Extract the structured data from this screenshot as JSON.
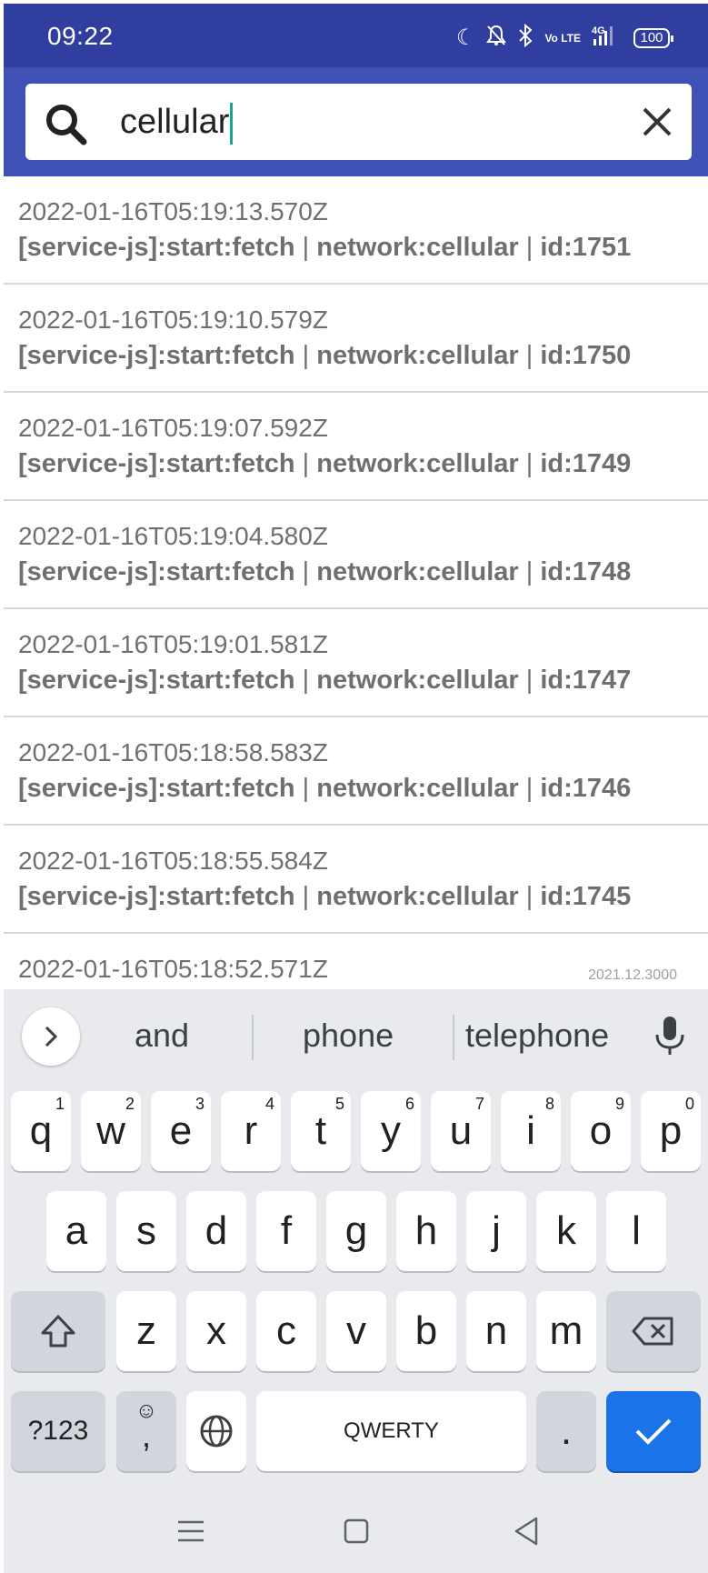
{
  "status_bar": {
    "time": "09:22",
    "battery": "100",
    "network": "4G",
    "volte": "Vo LTE"
  },
  "search": {
    "value": "cellular"
  },
  "logs": [
    {
      "timestamp": "2022-01-16T05:19:13.570Z",
      "source": "[service-js]:start:fetch",
      "network": "network:cellular",
      "id": "id:1751"
    },
    {
      "timestamp": "2022-01-16T05:19:10.579Z",
      "source": "[service-js]:start:fetch",
      "network": "network:cellular",
      "id": "id:1750"
    },
    {
      "timestamp": "2022-01-16T05:19:07.592Z",
      "source": "[service-js]:start:fetch",
      "network": "network:cellular",
      "id": "id:1749"
    },
    {
      "timestamp": "2022-01-16T05:19:04.580Z",
      "source": "[service-js]:start:fetch",
      "network": "network:cellular",
      "id": "id:1748"
    },
    {
      "timestamp": "2022-01-16T05:19:01.581Z",
      "source": "[service-js]:start:fetch",
      "network": "network:cellular",
      "id": "id:1747"
    },
    {
      "timestamp": "2022-01-16T05:18:58.583Z",
      "source": "[service-js]:start:fetch",
      "network": "network:cellular",
      "id": "id:1746"
    },
    {
      "timestamp": "2022-01-16T05:18:55.584Z",
      "source": "[service-js]:start:fetch",
      "network": "network:cellular",
      "id": "id:1745"
    },
    {
      "timestamp": "2022-01-16T05:18:52.571Z",
      "source": "",
      "network": "",
      "id": ""
    }
  ],
  "app_version": "2021.12.3000",
  "keyboard": {
    "suggestions": [
      "and",
      "phone",
      "telephone"
    ],
    "row1": [
      {
        "k": "q",
        "n": "1"
      },
      {
        "k": "w",
        "n": "2"
      },
      {
        "k": "e",
        "n": "3"
      },
      {
        "k": "r",
        "n": "4"
      },
      {
        "k": "t",
        "n": "5"
      },
      {
        "k": "y",
        "n": "6"
      },
      {
        "k": "u",
        "n": "7"
      },
      {
        "k": "i",
        "n": "8"
      },
      {
        "k": "o",
        "n": "9"
      },
      {
        "k": "p",
        "n": "0"
      }
    ],
    "row2": [
      "a",
      "s",
      "d",
      "f",
      "g",
      "h",
      "j",
      "k",
      "l"
    ],
    "row3": [
      "z",
      "x",
      "c",
      "v",
      "b",
      "n",
      "m"
    ],
    "symbols_label": "?123",
    "emoji_comma": ",",
    "space_label": "QWERTY",
    "period_label": "."
  },
  "colors": {
    "status_bar": "#303f9f",
    "app_bar": "#3f51b5",
    "enter_key": "#1a73e8"
  }
}
